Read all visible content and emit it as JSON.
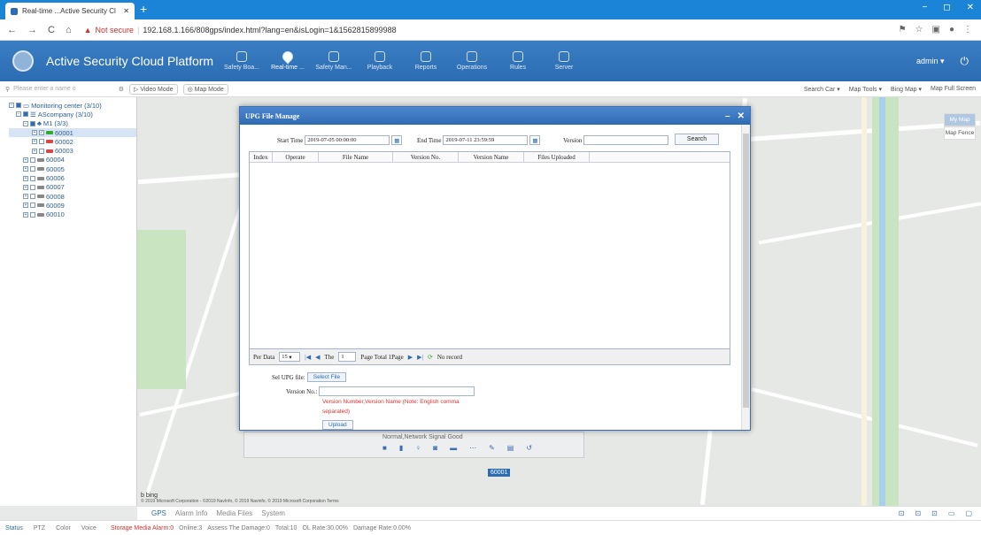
{
  "browser": {
    "tab_title": "Real-time ...Active Security Cl",
    "new_tab": "+",
    "security_label": "Not secure",
    "url": "192.168.1.166/808gps/index.html?lang=en&isLogin=1&1562815899988",
    "window_min": "−",
    "window_max": "◻",
    "window_close": "✕"
  },
  "app": {
    "title": "Active Security Cloud Platform",
    "user": "admin ▾",
    "menu": [
      {
        "label": "Safety Boa...",
        "icon": "shield-icon"
      },
      {
        "label": "Real-time ...",
        "icon": "location-icon",
        "active": true
      },
      {
        "label": "Safety Man...",
        "icon": "play-icon"
      },
      {
        "label": "Playback",
        "icon": "film-icon"
      },
      {
        "label": "Reports",
        "icon": "bar-chart-icon"
      },
      {
        "label": "Operations",
        "icon": "document-icon"
      },
      {
        "label": "Rules",
        "icon": "window-icon"
      },
      {
        "label": "Server",
        "icon": "server-icon"
      }
    ]
  },
  "toolbar": {
    "search_placeholder": "Please enter a name o",
    "video_mode": "Video Mode",
    "map_mode": "Map Mode",
    "map_tools": [
      "Search Car ▾",
      "Map Tools ▾",
      "Bing Map ▾",
      "Map Full Screen"
    ]
  },
  "tree": [
    {
      "label": "Monitoring center (3/10)",
      "level": 0
    },
    {
      "label": "AScompany (3/10)",
      "level": 1
    },
    {
      "label": "M1 (3/3)",
      "level": 2
    },
    {
      "label": "60001",
      "level": 3
    },
    {
      "label": "60002",
      "level": 3
    },
    {
      "label": "60003",
      "level": 3
    },
    {
      "label": "60004",
      "level": 2
    },
    {
      "label": "60005",
      "level": 2
    },
    {
      "label": "60006",
      "level": 2
    },
    {
      "label": "60007",
      "level": 2
    },
    {
      "label": "60008",
      "level": 2
    },
    {
      "label": "60009",
      "level": 2
    },
    {
      "label": "60010",
      "level": 2
    }
  ],
  "map": {
    "my_map": "My Map",
    "map_fence": "Map Fence",
    "bing": "b bing",
    "attribution": "© 2019 Microsoft Corporation - ©2019 NavInfo, © 2019 Navinfo, © 2019 Microsoft Corporation  Terms",
    "status_panel_title": "Normal,Network Signal Good",
    "vehicle_label": "60001"
  },
  "dialog": {
    "title": "UPG File Manage",
    "start_time_label": "Start Time",
    "start_time": "2019-07-05 00:00:00",
    "end_time_label": "End Time",
    "end_time": "2019-07-11 23:59:59",
    "version_label": "Version",
    "version_value": "",
    "search_button": "Search",
    "columns": [
      "Index",
      "Operate",
      "File Name",
      "Version No.",
      "Version Name",
      "Files Uploaded"
    ],
    "pager": {
      "per_data_label": "Per Data",
      "per_data": "15",
      "the_label": "The",
      "page": "1",
      "page_total": "Page  Total 1Page",
      "no_record": "No record"
    },
    "sel_file_label": "Sel UPG file:",
    "select_file_button": "Select File",
    "version_no_label": "Version No.:",
    "version_no_value": "",
    "note_line1": "Version Number,Version Name (Note: English comma",
    "note_line2": "separated)",
    "upload_button": "Upload"
  },
  "bottom_tabs": [
    "GPS",
    "Alarm Info",
    "Media Files",
    "System"
  ],
  "footer": {
    "tabs": [
      "Status",
      "PTZ",
      "Color",
      "Voice"
    ],
    "alarm_text": "Storage Media Alarm:0",
    "status_items": [
      "Online:3",
      "Assess The Damage:0",
      "Total:10",
      "OL Rate:30.00%",
      "Damage Rate:0.00%"
    ]
  }
}
